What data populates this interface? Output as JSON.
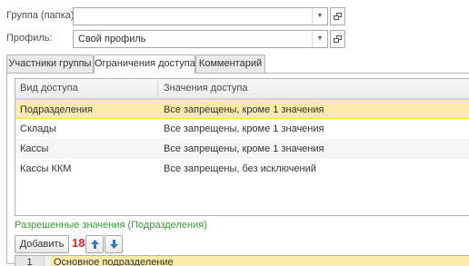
{
  "form": {
    "group_label": "Группа (папка):",
    "group_value": "",
    "profile_label": "Профиль:",
    "profile_value": "Свой профиль"
  },
  "tabs": [
    {
      "label": "Участники группы",
      "active": false
    },
    {
      "label": "Ограничения доступа",
      "active": true
    },
    {
      "label": "Комментарий",
      "active": false
    }
  ],
  "grid": {
    "columns": [
      "Вид доступа",
      "Значения доступа"
    ],
    "rows": [
      {
        "kind": "Подразделения",
        "value": "Все запрещены, кроме 1 значения",
        "selected": true
      },
      {
        "kind": "Склады",
        "value": "Все запрещены, кроме 1 значения",
        "selected": false
      },
      {
        "kind": "Кассы",
        "value": "Все запрещены, кроме 1 значения",
        "selected": false
      },
      {
        "kind": "Кассы ККМ",
        "value": "Все запрещены, без исключений",
        "selected": false
      }
    ]
  },
  "allowed": {
    "title": "Разрешенные значения (Подразделения)",
    "add_label": "Добавить",
    "annotation": "18",
    "first_row_num": "1",
    "first_row_value": "Основное подразделение"
  },
  "icons": {
    "dropdown": "chevron-down-icon",
    "open": "open-form-icon",
    "up": "arrow-up-icon",
    "down": "arrow-down-icon"
  },
  "colors": {
    "selected_row": "#fbeaa8",
    "section_title": "#3c9a3c",
    "annotation": "#e02020",
    "arrow_blue": "#2f78d2"
  }
}
